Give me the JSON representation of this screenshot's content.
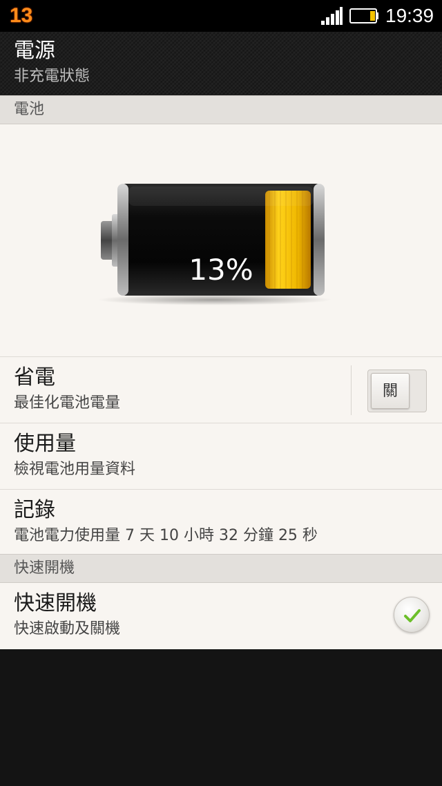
{
  "status_bar": {
    "notification_badge": "13",
    "time": "19:39",
    "icons": [
      "signal-icon",
      "battery-low-icon"
    ]
  },
  "header": {
    "title": "電源",
    "subtitle": "非充電狀態"
  },
  "sections": {
    "battery_header": "電池",
    "fastboot_header": "快速開機"
  },
  "battery": {
    "level": 13,
    "percent_label": "13%",
    "fill_color": "#f5c400"
  },
  "settings": {
    "power_saver": {
      "title": "省電",
      "summary": "最佳化電池電量",
      "toggle_label": "關"
    },
    "usage": {
      "title": "使用量",
      "summary": "檢視電池用量資料"
    },
    "history": {
      "title": "記錄",
      "summary": "電池電力使用量 7 天 10 小時 32 分鐘 25 秒"
    },
    "fastboot": {
      "title": "快速開機",
      "summary": "快速啟動及關機",
      "checked": true
    }
  },
  "colors": {
    "accent_check": "#6cbf2a",
    "background": "#f8f5f1",
    "section_header": "#e3e0dc"
  }
}
